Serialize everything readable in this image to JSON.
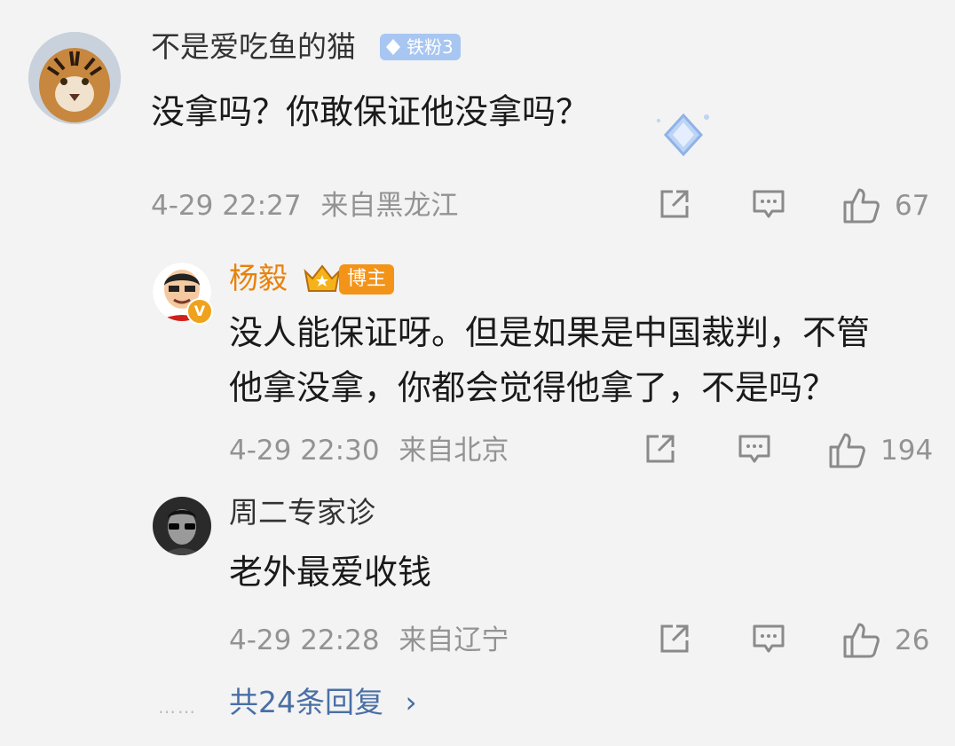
{
  "comments": [
    {
      "username": "不是爱吃鱼的猫",
      "badge": "铁粉3",
      "text_lines": [
        "没拿吗？你敢保证他没拿吗？"
      ],
      "time": "4-29 22:27",
      "location": "来自黑龙江",
      "likes": "67",
      "avatar_icon": "tiger-avatar"
    },
    {
      "username": "杨毅",
      "badge": "博主",
      "text_lines": [
        "没人能保证呀。但是如果是中国裁判，不管",
        "他拿没拿，你都会觉得他拿了，不是吗？"
      ],
      "time": "4-29 22:30",
      "location": "来自北京",
      "likes": "194",
      "avatar_icon": "cartoon-avatar",
      "verified_mark": "V"
    },
    {
      "username": "周二专家诊",
      "text_lines": [
        "老外最爱收钱"
      ],
      "time": "4-29 22:28",
      "location": "来自辽宁",
      "likes": "26",
      "avatar_icon": "sunglasses-avatar"
    }
  ],
  "more_dots": "……",
  "view_replies": "共24条回复",
  "view_replies_chevron": "›",
  "colors": {
    "background": "#f3f3f3",
    "blogger_name": "#e8820c",
    "blogger_badge": "#f39318",
    "fan_badge": "#a8c6f2",
    "link": "#4a6fa5",
    "meta": "#939393"
  }
}
